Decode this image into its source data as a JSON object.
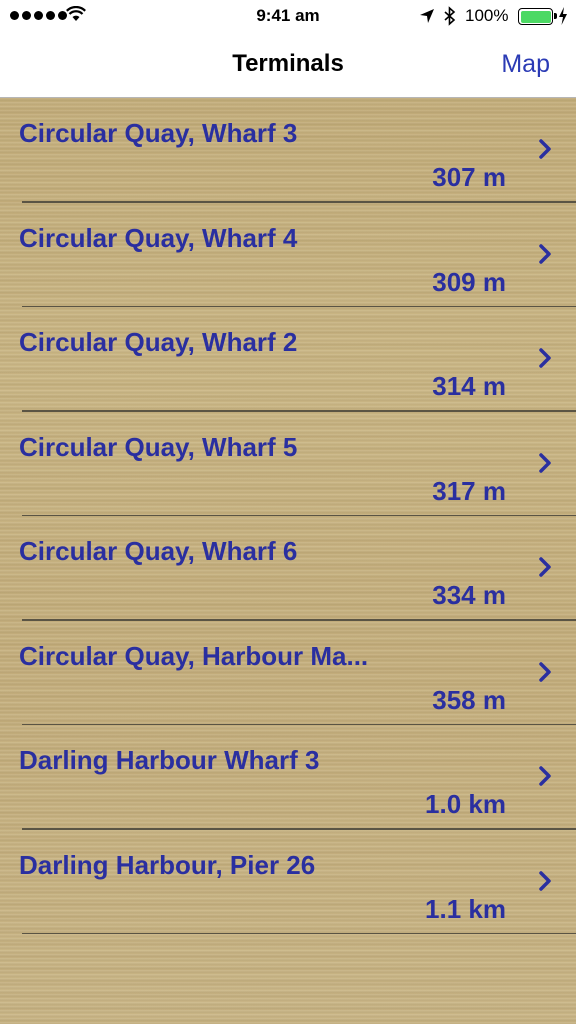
{
  "status_bar": {
    "time": "9:41 am",
    "battery": "100%",
    "signal_icon": "signal-dots-icon",
    "wifi_icon": "wifi-icon",
    "location_icon": "location-arrow-icon",
    "bluetooth_icon": "bluetooth-icon",
    "battery_icon": "battery-full-icon",
    "charging_icon": "charging-bolt-icon"
  },
  "nav": {
    "title": "Terminals",
    "map_button": "Map"
  },
  "colors": {
    "text_accent": "#2a2fa0",
    "nav_link": "#2b3bb5",
    "battery_fill": "#4cd964"
  },
  "terminals": [
    {
      "name": "Circular Quay, Wharf 3",
      "distance": "307 m"
    },
    {
      "name": "Circular Quay, Wharf 4",
      "distance": "309 m"
    },
    {
      "name": "Circular Quay, Wharf 2",
      "distance": "314 m"
    },
    {
      "name": "Circular Quay, Wharf 5",
      "distance": "317 m"
    },
    {
      "name": "Circular Quay, Wharf 6",
      "distance": "334 m"
    },
    {
      "name": "Circular Quay, Harbour Ma...",
      "distance": "358 m"
    },
    {
      "name": "Darling Harbour Wharf 3",
      "distance": "1.0 km"
    },
    {
      "name": "Darling Harbour, Pier 26",
      "distance": "1.1 km"
    }
  ]
}
